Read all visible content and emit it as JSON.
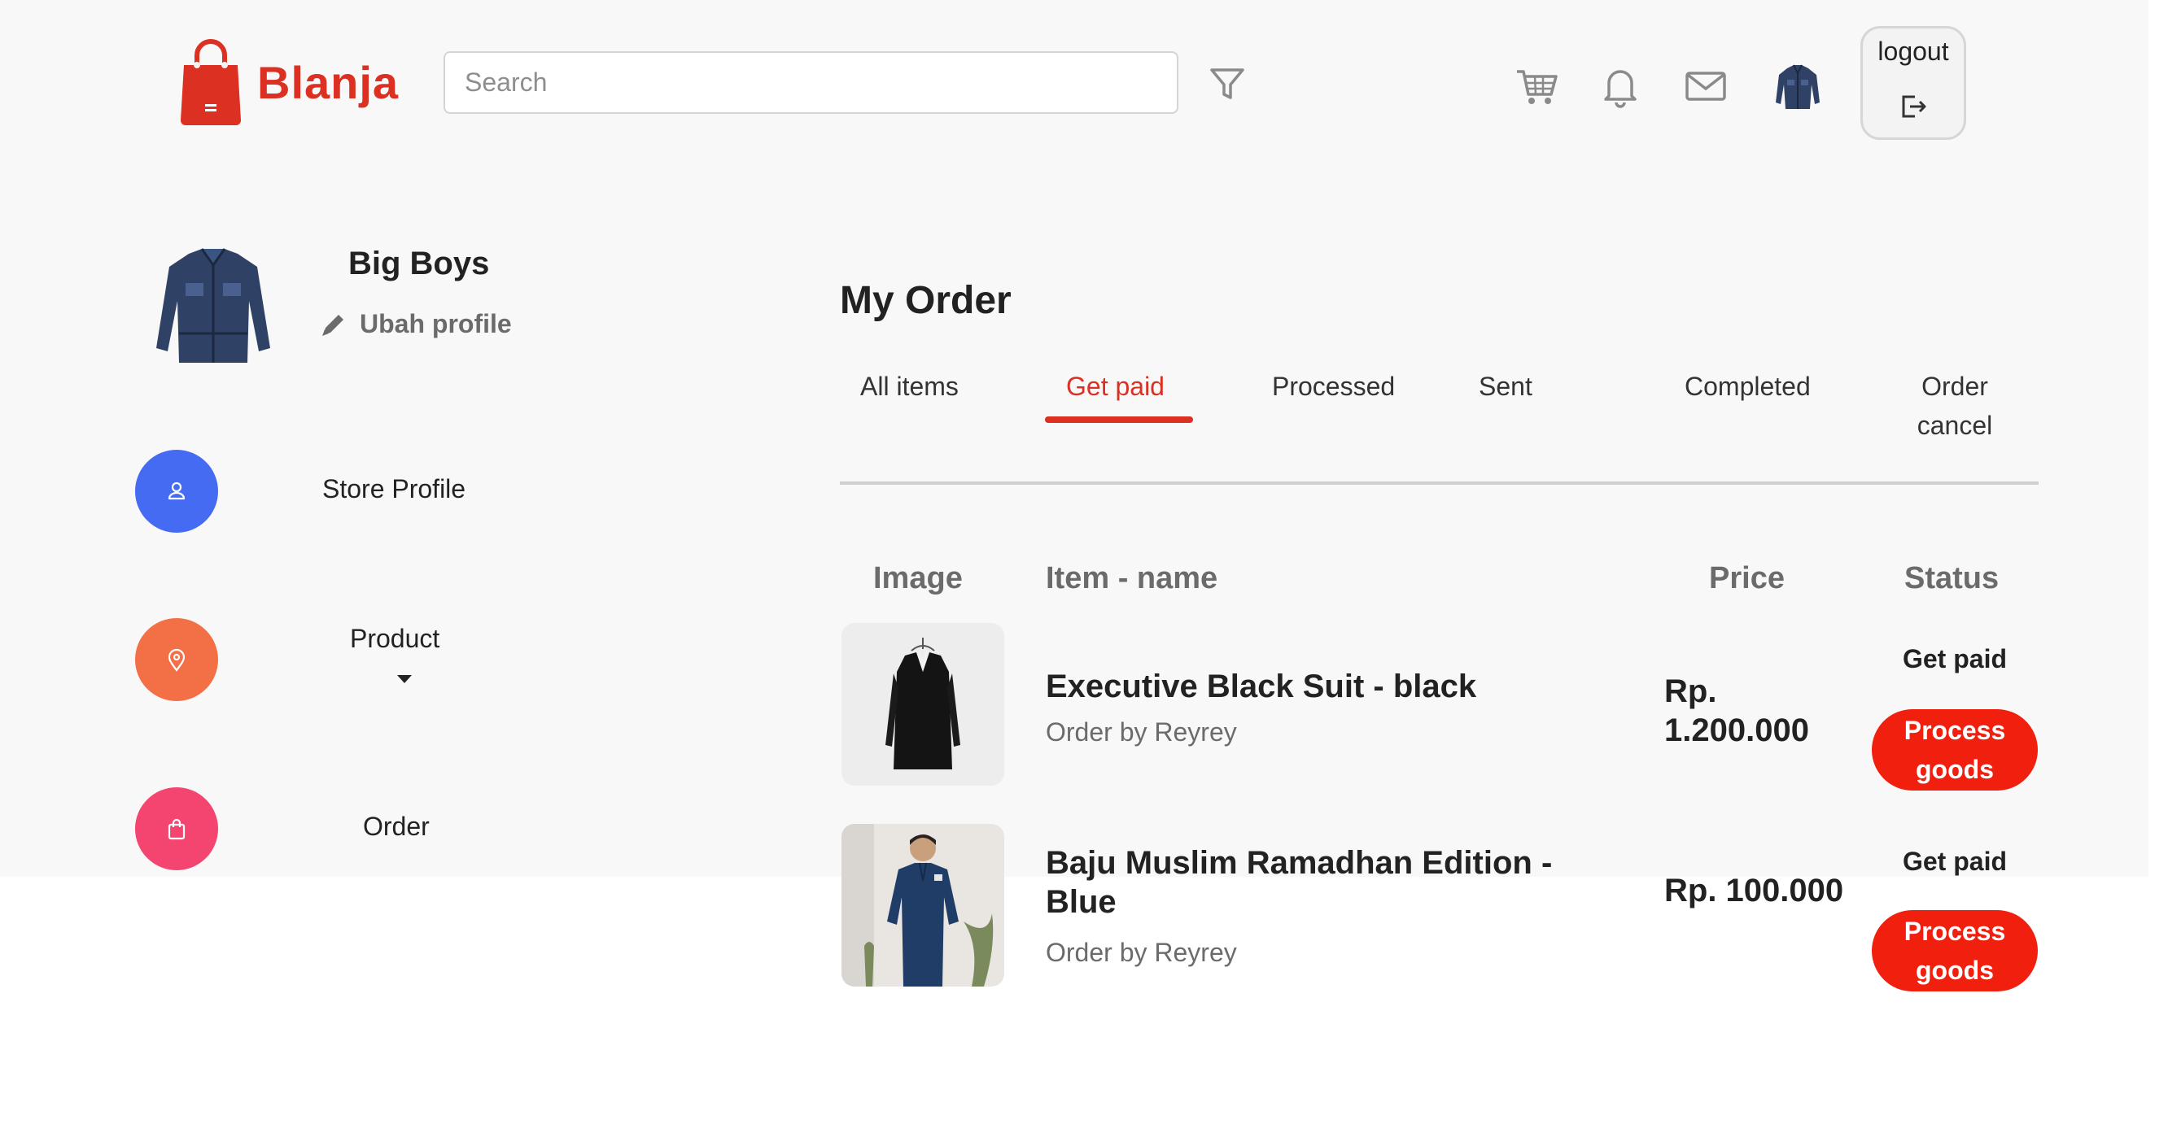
{
  "brand": {
    "name": "Blanja",
    "color": "#db3022"
  },
  "search": {
    "placeholder": "Search",
    "value": ""
  },
  "header": {
    "icons": [
      "filter-icon",
      "cart-icon",
      "bell-icon",
      "mail-icon",
      "avatar"
    ],
    "logout_label": "logout"
  },
  "profile": {
    "name": "Big Boys",
    "edit_label": "Ubah profile"
  },
  "sidebar": {
    "items": [
      {
        "label": "Store Profile",
        "icon": "user-icon",
        "color": "#456bf3"
      },
      {
        "label": "Product",
        "icon": "location-pin-icon",
        "color": "#f36f45"
      },
      {
        "label": "Order",
        "icon": "shopping-bag-icon",
        "color": "#f3456f"
      }
    ]
  },
  "main": {
    "title": "My Order",
    "tabs": [
      {
        "label": "All items"
      },
      {
        "label": "Get paid",
        "active": true
      },
      {
        "label": "Processed"
      },
      {
        "label": "Sent"
      },
      {
        "label": "Completed"
      },
      {
        "label": "Order cancel"
      }
    ],
    "columns": [
      "Image",
      "Item - name",
      "Price",
      "Status"
    ],
    "orders": [
      {
        "name": "Executive Black Suit - black",
        "seller": "Order by Reyrey",
        "price": "Rp. 1.200.000",
        "status": "Get paid",
        "action": "Process goods"
      },
      {
        "name": "Baju Muslim Ramadhan Edition - Blue",
        "seller": "Order by Reyrey",
        "price": "Rp. 100.000",
        "status": "Get paid",
        "action": "Process goods"
      }
    ]
  },
  "colors": {
    "accent": "#db3022",
    "action_button": "#f01f0e"
  }
}
